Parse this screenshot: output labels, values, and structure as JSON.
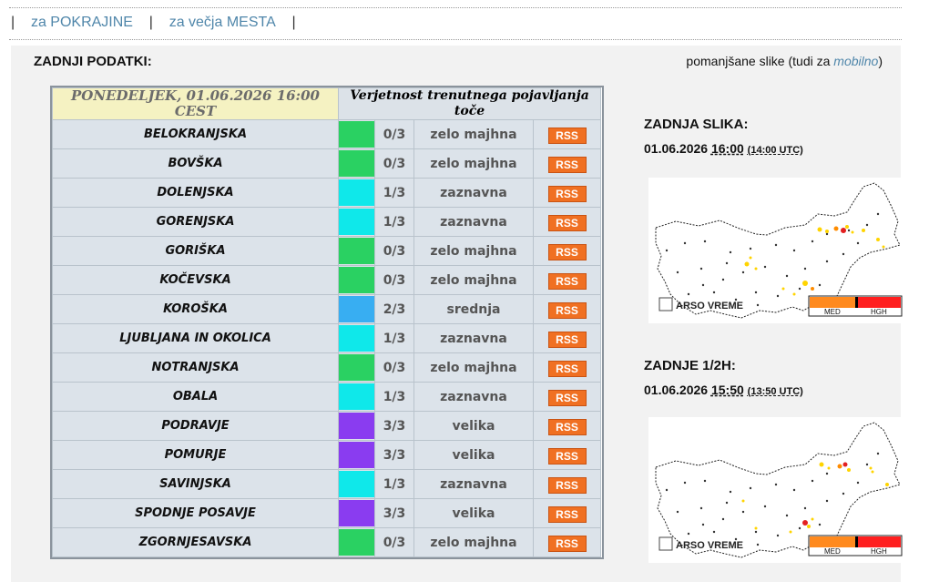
{
  "nav": {
    "sep": "|",
    "link1": "za POKRAJINE",
    "link2": "za večja MESTA"
  },
  "panel": {
    "title": "ZADNJI PODATKI:",
    "right_prefix": "pomanjšane slike (tudi za ",
    "right_link": "mobilno",
    "right_suffix": ")"
  },
  "table": {
    "date_header": "PONEDELJEK, 01.06.2026 16:00 CEST",
    "prob_header": "Verjetnost trenutnega pojavljanja toče",
    "rss_label": "RSS",
    "rows": [
      {
        "name": "BELOKRANJSKA",
        "frac": "0/3",
        "level": "zelo majhna",
        "color": "#2ad162"
      },
      {
        "name": "BOVŠKA",
        "frac": "0/3",
        "level": "zelo majhna",
        "color": "#2ad162"
      },
      {
        "name": "DOLENJSKA",
        "frac": "1/3",
        "level": "zaznavna",
        "color": "#0fe8ea"
      },
      {
        "name": "GORENJSKA",
        "frac": "1/3",
        "level": "zaznavna",
        "color": "#0fe8ea"
      },
      {
        "name": "GORIŠKA",
        "frac": "0/3",
        "level": "zelo majhna",
        "color": "#2ad162"
      },
      {
        "name": "KOČEVSKA",
        "frac": "0/3",
        "level": "zelo majhna",
        "color": "#2ad162"
      },
      {
        "name": "KOROŠKA",
        "frac": "2/3",
        "level": "srednja",
        "color": "#38aef2"
      },
      {
        "name": "LJUBLJANA IN OKOLICA",
        "frac": "1/3",
        "level": "zaznavna",
        "color": "#0fe8ea"
      },
      {
        "name": "NOTRANJSKA",
        "frac": "0/3",
        "level": "zelo majhna",
        "color": "#2ad162"
      },
      {
        "name": "OBALA",
        "frac": "1/3",
        "level": "zaznavna",
        "color": "#0fe8ea"
      },
      {
        "name": "PODRAVJE",
        "frac": "3/3",
        "level": "velika",
        "color": "#8a3cf0"
      },
      {
        "name": "POMURJE",
        "frac": "3/3",
        "level": "velika",
        "color": "#8a3cf0"
      },
      {
        "name": "SAVINJSKA",
        "frac": "1/3",
        "level": "zaznavna",
        "color": "#0fe8ea"
      },
      {
        "name": "SPODNJE POSAVJE",
        "frac": "3/3",
        "level": "velika",
        "color": "#8a3cf0"
      },
      {
        "name": "ZGORNJESAVSKA",
        "frac": "0/3",
        "level": "zelo majhna",
        "color": "#2ad162"
      }
    ]
  },
  "maps": [
    {
      "title": "ZADNJA SLIKA:",
      "date": "01.06.2026",
      "time": "16:00",
      "utc": "(14:00 UTC)",
      "brand": "ARSO VREME",
      "legend_med": "MED",
      "legend_high": "HGH"
    },
    {
      "title": "ZADNJE 1/2H:",
      "date": "01.06.2026",
      "time": "15:50",
      "utc": "(13:50 UTC)",
      "brand": "ARSO VREME",
      "legend_med": "MED",
      "legend_high": "HGH"
    }
  ]
}
